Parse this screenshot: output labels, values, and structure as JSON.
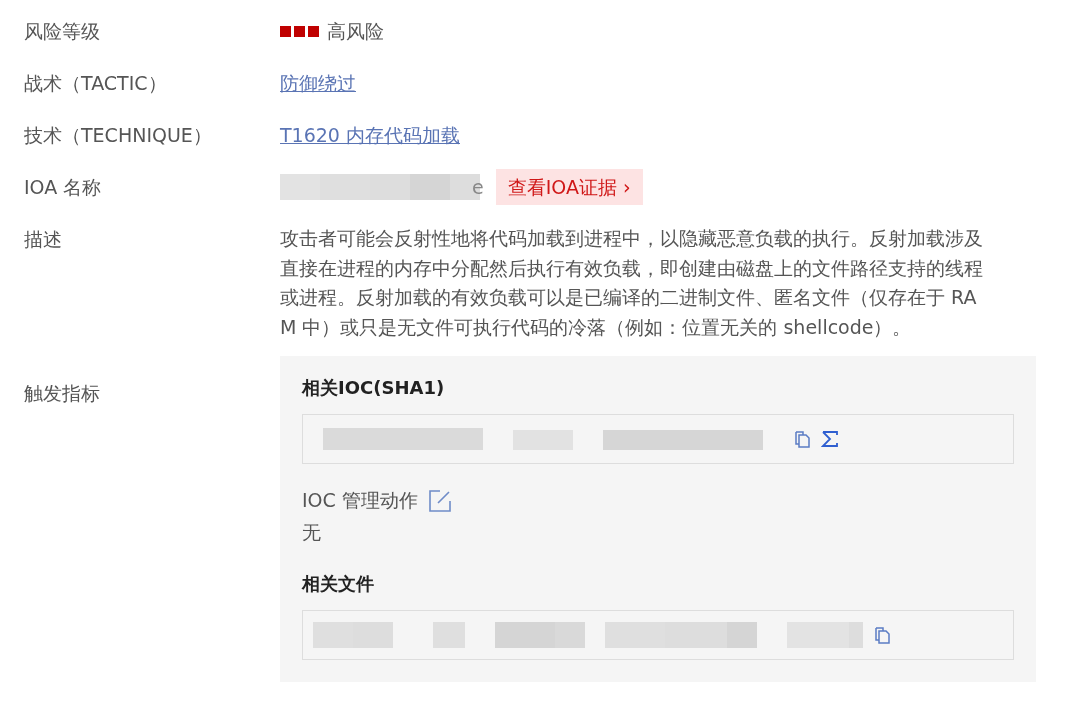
{
  "rows": [
    {
      "kind": "risk",
      "label": "风险等级",
      "value": "高风险"
    },
    {
      "kind": "link",
      "label": "战术（TACTIC）",
      "value": "防御绕过"
    },
    {
      "kind": "link",
      "label": "技术（TECHNIQUE）",
      "value": "T1620 内存代码加载"
    },
    {
      "kind": "ioa",
      "label": "IOA 名称",
      "value_tail": "e",
      "button": "查看IOA证据 ›"
    },
    {
      "kind": "text",
      "label": "描述",
      "value": "攻击者可能会反射性地将代码加载到进程中，以隐藏恶意负载的执行。反射加载涉及直接在进程的内存中分配然后执行有效负载，即创建由磁盘上的文件路径支持的线程或进程。反射加载的有效负载可以是已编译的二进制文件、匿名文件（仅存在于 RAM 中）或只是无文件可执行代码的冷落（例如：位置无关的 shellcode）。"
    },
    {
      "kind": "indicators",
      "label": "触发指标",
      "ioc_title": "相关IOC(SHA1)",
      "action_label": "IOC 管理动作",
      "action_value": "无",
      "file_title": "相关文件"
    }
  ]
}
